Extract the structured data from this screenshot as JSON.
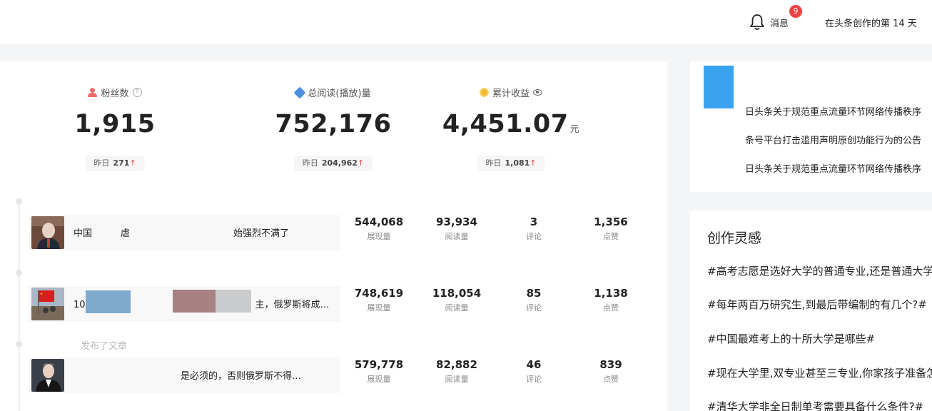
{
  "header": {
    "bell_icon": "bell-icon",
    "message_badge": "9",
    "message_label": "消息",
    "creation_days": "在头条创作的第 14 天"
  },
  "stats": [
    {
      "icon": "user-icon",
      "title": "粉丝数",
      "extra_icon": "help-icon",
      "extra_glyph": "?",
      "value": "1,915",
      "unit": "",
      "yesterday_label": "昨日",
      "yesterday_value": "271",
      "trend": "↑"
    },
    {
      "icon": "read-icon",
      "title": "总阅读(播放)量",
      "extra_icon": "",
      "value": "752,176",
      "unit": "",
      "yesterday_label": "昨日",
      "yesterday_value": "204,962",
      "trend": "↑"
    },
    {
      "icon": "coin-icon",
      "title": "累计收益",
      "extra_icon": "eye-icon",
      "value": "4,451.07",
      "unit": "元",
      "yesterday_label": "昨日",
      "yesterday_value": "1,081",
      "trend": "↑"
    }
  ],
  "timeline": {
    "faded_label_3": "发布了文章"
  },
  "articles": [
    {
      "title_left": "中国",
      "title_mid": "虐",
      "title_right": "始强烈不满了",
      "metrics": [
        {
          "value": "544,068",
          "label": "展现量"
        },
        {
          "value": "93,934",
          "label": "阅读量"
        },
        {
          "value": "3",
          "label": "评论"
        },
        {
          "value": "1,356",
          "label": "点赞"
        }
      ]
    },
    {
      "title_left": "10",
      "title_right": "主，俄罗斯将成…",
      "metrics": [
        {
          "value": "748,619",
          "label": "展现量"
        },
        {
          "value": "118,054",
          "label": "阅读量"
        },
        {
          "value": "85",
          "label": "评论"
        },
        {
          "value": "1,138",
          "label": "点赞"
        }
      ]
    },
    {
      "title_left": "",
      "title_right": "是必须的，否则俄罗斯不得…",
      "metrics": [
        {
          "value": "579,778",
          "label": "展现量"
        },
        {
          "value": "82,882",
          "label": "阅读量"
        },
        {
          "value": "46",
          "label": "评论"
        },
        {
          "value": "839",
          "label": "点赞"
        }
      ]
    }
  ],
  "notices": [
    "日头条关于规范重点流量环节网络传播秩序",
    "条号平台打击滥用声明原创功能行为的公告",
    "日头条关于规范重点流量环节网络传播秩序"
  ],
  "inspiration": {
    "title": "创作灵感",
    "topics": [
      "#高考志愿是选好大学的普通专业,还是普通大学的好专业#",
      "#每年两百万研究生,到最后带编制的有几个?#",
      "#中国最难考上的十所大学是哪些#",
      "#现在大学里,双专业甚至三专业,你家孩子准备怎么选#",
      "#清华大学非全日制单考需要具备什么条件?#"
    ]
  },
  "colors": {
    "accent_red": "#f04142",
    "notice_image": "#3aa3f0",
    "coin": "#f5b82e",
    "read": "#4a90e2"
  }
}
